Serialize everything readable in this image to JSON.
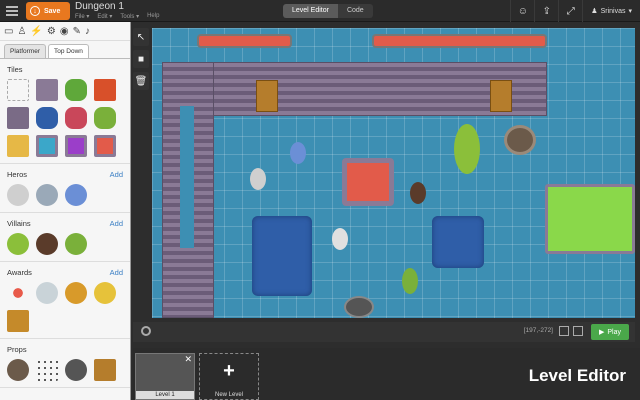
{
  "app": {
    "save_label": "Save",
    "document_title": "Dungeon 1",
    "menu": [
      "File ▾",
      "Edit ▾",
      "Tools ▾",
      "Help"
    ],
    "mode_tabs": [
      "Level Editor",
      "Code"
    ],
    "active_mode": "Level Editor",
    "user_name": "Srinivas",
    "accent_color": "#e8781f",
    "play_color": "#4aa84a"
  },
  "left_panel": {
    "tool_icons": [
      "image-icon",
      "person-icon",
      "runner-icon",
      "robot-icon",
      "camera-icon",
      "brush-icon",
      "microphone-icon"
    ],
    "tabs": [
      "Platformer",
      "Top Down"
    ],
    "active_tab": "Top Down",
    "sections": [
      {
        "title": "Tiles",
        "add": ""
      },
      {
        "title": "Heros",
        "add": "Add"
      },
      {
        "title": "Villains",
        "add": "Add"
      },
      {
        "title": "Awards",
        "add": "Add"
      },
      {
        "title": "Props",
        "add": ""
      }
    ]
  },
  "canvas": {
    "coordinates": "[197,-272]",
    "play_label": "Play"
  },
  "levels": {
    "items": [
      {
        "label": "Level 1"
      }
    ],
    "new_level_label": "New Level",
    "plus": "+",
    "close": "✕"
  },
  "branding": {
    "label": "Level Editor"
  }
}
